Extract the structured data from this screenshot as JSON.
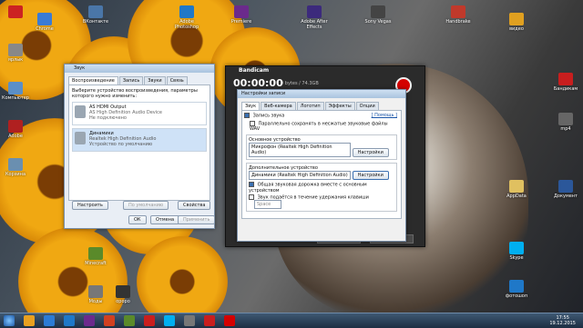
{
  "desktop": {
    "left_icons": [
      {
        "label": "",
        "color": "#cc2222"
      },
      {
        "label": "Chrome",
        "color": "#3a7bd5"
      },
      {
        "label": "ярлык",
        "color": "#888"
      },
      {
        "label": "Компьютер",
        "color": "#5b8fc7"
      },
      {
        "label": "Adobe",
        "color": "#b02020"
      },
      {
        "label": "Корзина",
        "color": "#6a8fb0"
      }
    ],
    "top_icons": [
      {
        "label": "ВКонтакте",
        "color": "#4a76a8"
      },
      {
        "label": "Adobe Photoshop",
        "color": "#1f78c8"
      },
      {
        "label": "Premiere",
        "color": "#6b2a8c"
      },
      {
        "label": "Adobe After Effects",
        "color": "#3c2a7c"
      },
      {
        "label": "Sony Vegas",
        "color": "#444"
      },
      {
        "label": "Handbrake",
        "color": "#c0392b"
      }
    ],
    "right_icons": [
      {
        "label": "видео",
        "color": "#e0a020"
      },
      {
        "label": "Бандикам",
        "color": "#c81e1e"
      },
      {
        "label": "mp4",
        "color": "#666"
      },
      {
        "label": "AppData",
        "color": "#e0c060"
      },
      {
        "label": "Документ",
        "color": "#2b579a"
      },
      {
        "label": "Skype",
        "color": "#00aff0"
      },
      {
        "label": "фотошоп",
        "color": "#1f78c8"
      }
    ],
    "bottom_icons": [
      {
        "label": "Minecraft",
        "color": "#5a8a2a"
      },
      {
        "label": "Моды",
        "color": "#777"
      },
      {
        "label": "ороро",
        "color": "#333"
      }
    ]
  },
  "sound_dialog": {
    "title": "Звук",
    "tabs": [
      "Воспроизведение",
      "Запись",
      "Звуки",
      "Связь"
    ],
    "instruction": "Выберите устройство воспроизведения, параметры которого нужно изменить:",
    "devices": [
      {
        "name": "AS HDMI Output",
        "desc": "AS High Definition Audio Device",
        "status": "Не подключено",
        "selected": false
      },
      {
        "name": "Динамики",
        "desc": "Realtek High Definition Audio",
        "status": "Устройство по умолчанию",
        "selected": true
      }
    ],
    "configure": "Настроить",
    "default": "По умолчанию",
    "properties": "Свойства",
    "ok": "ОК",
    "cancel": "Отмена",
    "apply": "Применить"
  },
  "bandicam": {
    "title": "Bandicam",
    "time": "00:00:00",
    "size": "0 bytes / 74.3GB",
    "settings_btn": "Настройки",
    "templates_btn": "Шаблоны"
  },
  "record_settings": {
    "title": "Настройки записи",
    "tabs": [
      "Звук",
      "Веб-камера",
      "Логотип",
      "Эффекты",
      "Опции"
    ],
    "record_sound": "Запись звука",
    "help": "[ Помощь ]",
    "parallel_save": "Параллельно сохранять в несжатые звуковые файлы WAV",
    "main_device_label": "Основное устройство",
    "main_device": "Микрофон (Realtek High Definition Audio)",
    "extra_device_label": "Дополнительное устройство",
    "extra_device": "Динамики (Realtek High Definition Audio)",
    "configure": "Настройки",
    "mix_option": "Общая звуковая дорожка вместе с основным устройством",
    "hold_key": "Звук подаётся в течение удержания клавиши",
    "key": "Space"
  },
  "taskbar": {
    "time": "17:55",
    "date": "19.12.2015"
  }
}
